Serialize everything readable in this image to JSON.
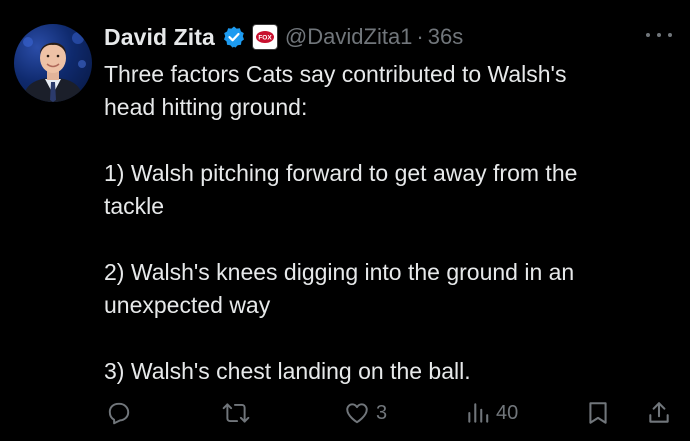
{
  "tweet": {
    "author": {
      "display_name": "David Zita",
      "handle": "@DavidZita1",
      "verified_icon": "verified-badge-icon",
      "affiliate_badge_icon": "fox-sports-badge-icon",
      "affiliate_badge_text": "FOX"
    },
    "separator": "·",
    "time": "36s",
    "more_icon": "more-dots-icon",
    "text": {
      "intro_line1": "Three factors Cats say contributed to Walsh's",
      "intro_line2": "head hitting ground:",
      "point1_line1": "1) Walsh pitching forward to get away from the",
      "point1_line2": "tackle",
      "point2_line1": "2) Walsh's knees digging into the ground in an",
      "point2_line2": "unexpected way",
      "point3_line1": "3) Walsh's chest landing on the ball."
    },
    "actions": {
      "reply": {
        "icon": "reply-icon",
        "count": ""
      },
      "retweet": {
        "icon": "retweet-icon",
        "count": ""
      },
      "like": {
        "icon": "heart-icon",
        "count": "3"
      },
      "views": {
        "icon": "analytics-icon",
        "count": "40"
      },
      "bookmark": {
        "icon": "bookmark-icon"
      },
      "share": {
        "icon": "share-icon"
      }
    },
    "colors": {
      "background": "#000000",
      "text": "#e7e9ea",
      "secondary": "#71767b",
      "verified": "#1d9bf0"
    }
  }
}
